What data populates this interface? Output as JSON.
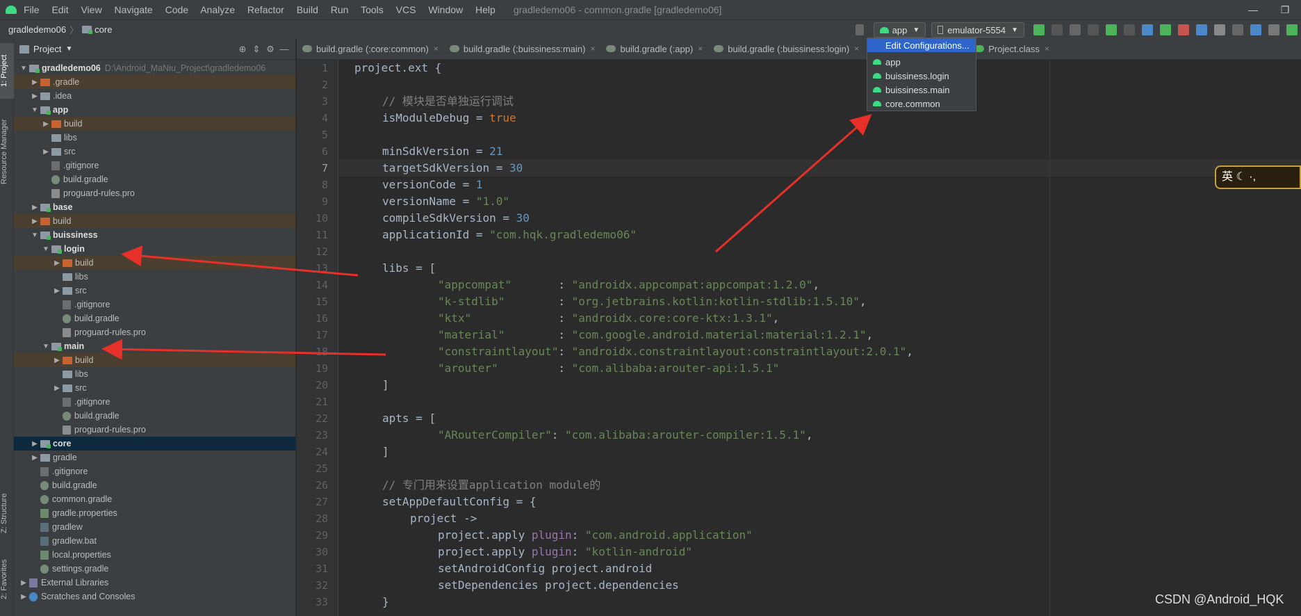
{
  "menu": [
    "File",
    "Edit",
    "View",
    "Navigate",
    "Code",
    "Analyze",
    "Refactor",
    "Build",
    "Run",
    "Tools",
    "VCS",
    "Window",
    "Help"
  ],
  "window_title": "gradledemo06 - common.gradle [gradledemo06]",
  "window_controls": [
    "—",
    "❐"
  ],
  "breadcrumb": {
    "project": "gradledemo06",
    "module": "core"
  },
  "toolbar": {
    "config": "app",
    "device": "emulator-5554"
  },
  "side_tabs": {
    "project": "1: Project",
    "resource_manager": "Resource Manager",
    "structure": "Z: Structure",
    "favorites": "2: Favorites"
  },
  "project_panel": {
    "title": "Project"
  },
  "tree": [
    {
      "label": "gradledemo06",
      "path": "D:\\Android_MaNiu_Project\\gradledemo06"
    },
    {
      "label": ".gradle"
    },
    {
      "label": ".idea"
    },
    {
      "label": "app"
    },
    {
      "label": "build"
    },
    {
      "label": "libs"
    },
    {
      "label": "src"
    },
    {
      "label": ".gitignore"
    },
    {
      "label": "build.gradle"
    },
    {
      "label": "proguard-rules.pro"
    },
    {
      "label": "base"
    },
    {
      "label": "build"
    },
    {
      "label": "buissiness"
    },
    {
      "label": "login"
    },
    {
      "label": "build"
    },
    {
      "label": "libs"
    },
    {
      "label": "src"
    },
    {
      "label": ".gitignore"
    },
    {
      "label": "build.gradle"
    },
    {
      "label": "proguard-rules.pro"
    },
    {
      "label": "main"
    },
    {
      "label": "build"
    },
    {
      "label": "libs"
    },
    {
      "label": "src"
    },
    {
      "label": ".gitignore"
    },
    {
      "label": "build.gradle"
    },
    {
      "label": "proguard-rules.pro"
    },
    {
      "label": "core"
    },
    {
      "label": "gradle"
    },
    {
      "label": ".gitignore"
    },
    {
      "label": "build.gradle"
    },
    {
      "label": "common.gradle"
    },
    {
      "label": "gradle.properties"
    },
    {
      "label": "gradlew"
    },
    {
      "label": "gradlew.bat"
    },
    {
      "label": "local.properties"
    },
    {
      "label": "settings.gradle"
    },
    {
      "label": "External Libraries"
    },
    {
      "label": "Scratches and Consoles"
    }
  ],
  "tabs": [
    "build.gradle (:core:common)",
    "build.gradle (:buissiness:main)",
    "build.gradle (:app)",
    "build.gradle (:buissiness:login)",
    "Project.class"
  ],
  "dropdown": {
    "edit": "Edit Configurations...",
    "items": [
      "app",
      "buissiness.login",
      "buissiness.main",
      "core.common"
    ]
  },
  "code": {
    "l1": "project.ext {",
    "l3": "// 模块是否单独运行调试",
    "l4a": "isModuleDebug = ",
    "l4b": "true",
    "l6a": "minSdkVersion = ",
    "l6b": "21",
    "l7a": "targetSdkVersion = ",
    "l7b": "30",
    "l8a": "versionCode = ",
    "l8b": "1",
    "l9a": "versionName = ",
    "l9b": "\"1.0\"",
    "l10a": "compileSdkVersion = ",
    "l10b": "30",
    "l11a": "applicationId = ",
    "l11b": "\"com.hqk.gradledemo06\"",
    "l13": "libs = [",
    "l14a": "\"appcompat\"       ",
    "l14b": ": ",
    "l14c": "\"androidx.appcompat:appcompat:1.2.0\"",
    "l14d": ",",
    "l15a": "\"k-stdlib\"        ",
    "l15b": ": ",
    "l15c": "\"org.jetbrains.kotlin:kotlin-stdlib:1.5.10\"",
    "l15d": ",",
    "l16a": "\"ktx\"             ",
    "l16b": ": ",
    "l16c": "\"androidx.core:core-ktx:1.3.1\"",
    "l16d": ",",
    "l17a": "\"material\"        ",
    "l17b": ": ",
    "l17c": "\"com.google.android.material:material:1.2.1\"",
    "l17d": ",",
    "l18a": "\"constraintlayout\"",
    "l18b": ": ",
    "l18c": "\"androidx.constraintlayout:constraintlayout:2.0.1\"",
    "l18d": ",",
    "l19a": "\"arouter\"         ",
    "l19b": ": ",
    "l19c": "\"com.alibaba:arouter-api:1.5.1\"",
    "l20": "]",
    "l22": "apts = [",
    "l23a": "\"ARouterCompiler\"",
    "l23b": ": ",
    "l23c": "\"com.alibaba:arouter-compiler:1.5.1\"",
    "l23d": ",",
    "l24": "]",
    "l26": "// 专门用来设置application module的",
    "l27": "setAppDefaultConfig = {",
    "l28": "project ->",
    "l29a": "project.apply ",
    "l29b": "plugin",
    "l29c": ": ",
    "l29d": "\"com.android.application\"",
    "l30a": "project.apply ",
    "l30b": "plugin",
    "l30c": ": ",
    "l30d": "\"kotlin-android\"",
    "l31": "setAndroidConfig project.android",
    "l32": "setDependencies project.dependencies",
    "l33": "}"
  },
  "line_numbers": [
    "1",
    "2",
    "3",
    "4",
    "5",
    "6",
    "7",
    "8",
    "9",
    "10",
    "11",
    "12",
    "13",
    "14",
    "15",
    "16",
    "17",
    "18",
    "19",
    "20",
    "21",
    "22",
    "23",
    "24",
    "25",
    "26",
    "27",
    "28",
    "29",
    "30",
    "31",
    "32",
    "33"
  ],
  "current_line": 7,
  "badge_text": "英 ☾ ·,",
  "watermark": "CSDN @Android_HQK",
  "colors": {
    "keyword": "#cc7832",
    "string": "#6a8759",
    "number": "#6897bb",
    "comment": "#808080",
    "selection": "#2f65ca",
    "arrow": "#e8302a"
  }
}
